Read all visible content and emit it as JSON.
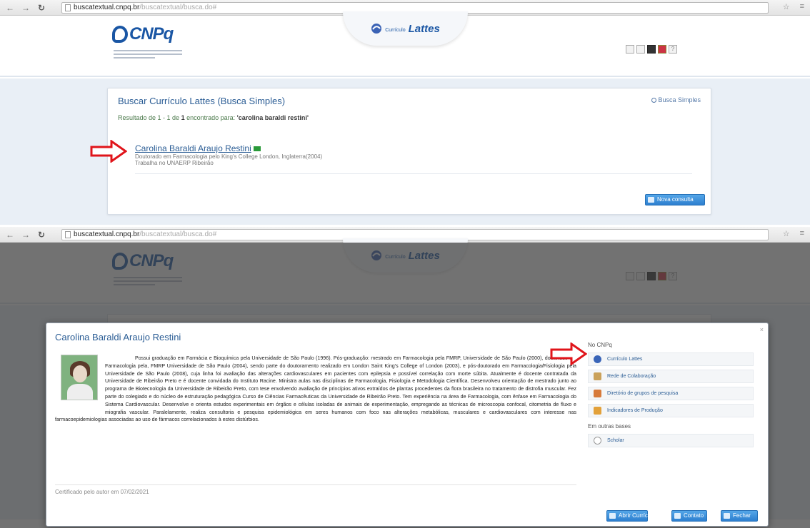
{
  "browser": {
    "url_host": "buscatextual.cnpq.br",
    "url_path": "/buscatextual/busca.do#"
  },
  "header": {
    "logo_text": "CNPq",
    "lattes_small": "Currículo",
    "lattes_big": "Lattes"
  },
  "search_panel": {
    "title": "Buscar Currículo Lattes (Busca Simples)",
    "busca_link": "Busca Simples",
    "results_prefix": "Resultado de 1 - 1 de ",
    "results_count": "1",
    "results_mid": " encontrado para: ",
    "results_query": "'carolina baraldi restini'",
    "result": {
      "name": "Carolina Baraldi Araujo Restini",
      "line1": "Doutorado em Farmacologia pelo King's College London, Inglaterra(2004)",
      "line2": "Trabalha no UNAERP Ribeirão"
    },
    "new_search_button": "Nova consulta"
  },
  "modal": {
    "name": "Carolina Baraldi Araujo Restini",
    "bio": "Possui graduação em Farmácia e Bioquímica pela Universidade de São Paulo (1996). Pós-graduação: mestrado em Farmacologia pela FMRP, Universidade de São Paulo (2000), doutorado em Farmacologia pela, FMRP Universidade de São Paulo (2004), sendo parte do doutoramento realizado em London Saint King's College of London (2003), e pós-doutorado em Farmacologia/Fisiologia pela Universidade de São Paulo (2008), cuja linha foi avaliação das alterações cardiovasculares em pacientes com epilepsia e possível correlação com morte súbita. Atualmente é docente contratada da Universidade de Ribeirão Preto e é docente convidada do Instituto Racine. Ministra aulas nas disciplinas de Farmacologia, Fisiologia e Metodologia Científica. Desenvolveu orientação de mestrado junto ao programa de Biotecnologia da Universidade de Ribeirão Preto, com tese envolvendo avaliação de princípios ativos extraídos de plantas procedentes da flora brasileira no tratamento de distrofia muscular. Fez parte do colegiado e do núcleo de estruturação pedagógica Curso de Ciências Farmacêuticas da Universidade de Ribeirão Preto. Tem experiência na área de Farmacologia, com ênfase em Farmacologia do Sistema Cardiovascular. Desenvolve e orienta estudos experimentais em órgãos e células isoladas de animais de experimentação, empregando as técnicas de microscopia confocal, citometria de fluxo e miografia vascular. Paralelamente, realiza consultoria e pesquisa epidemiológica em seres humanos com foco nas alterações metabólicas, musculares e cardiovasculares com interesse nas farmacoepidemiologias associadas ao uso de fármacos correlacionados à estes distúrbios.",
    "certified": "Certificado pelo autor em 07/02/2021",
    "side_heading": "No CNPq",
    "side_items": [
      {
        "label": "Currículo Lattes"
      },
      {
        "label": "Rede de Colaboração"
      },
      {
        "label": "Diretório de grupos de pesquisa"
      },
      {
        "label": "Indicadores de Produção"
      }
    ],
    "other_heading": "Em outras bases",
    "other_items": [
      {
        "label": "Scholar"
      }
    ],
    "buttons": {
      "abrir": "Abrir Currículo",
      "contato": "Contato",
      "fechar": "Fechar"
    }
  }
}
